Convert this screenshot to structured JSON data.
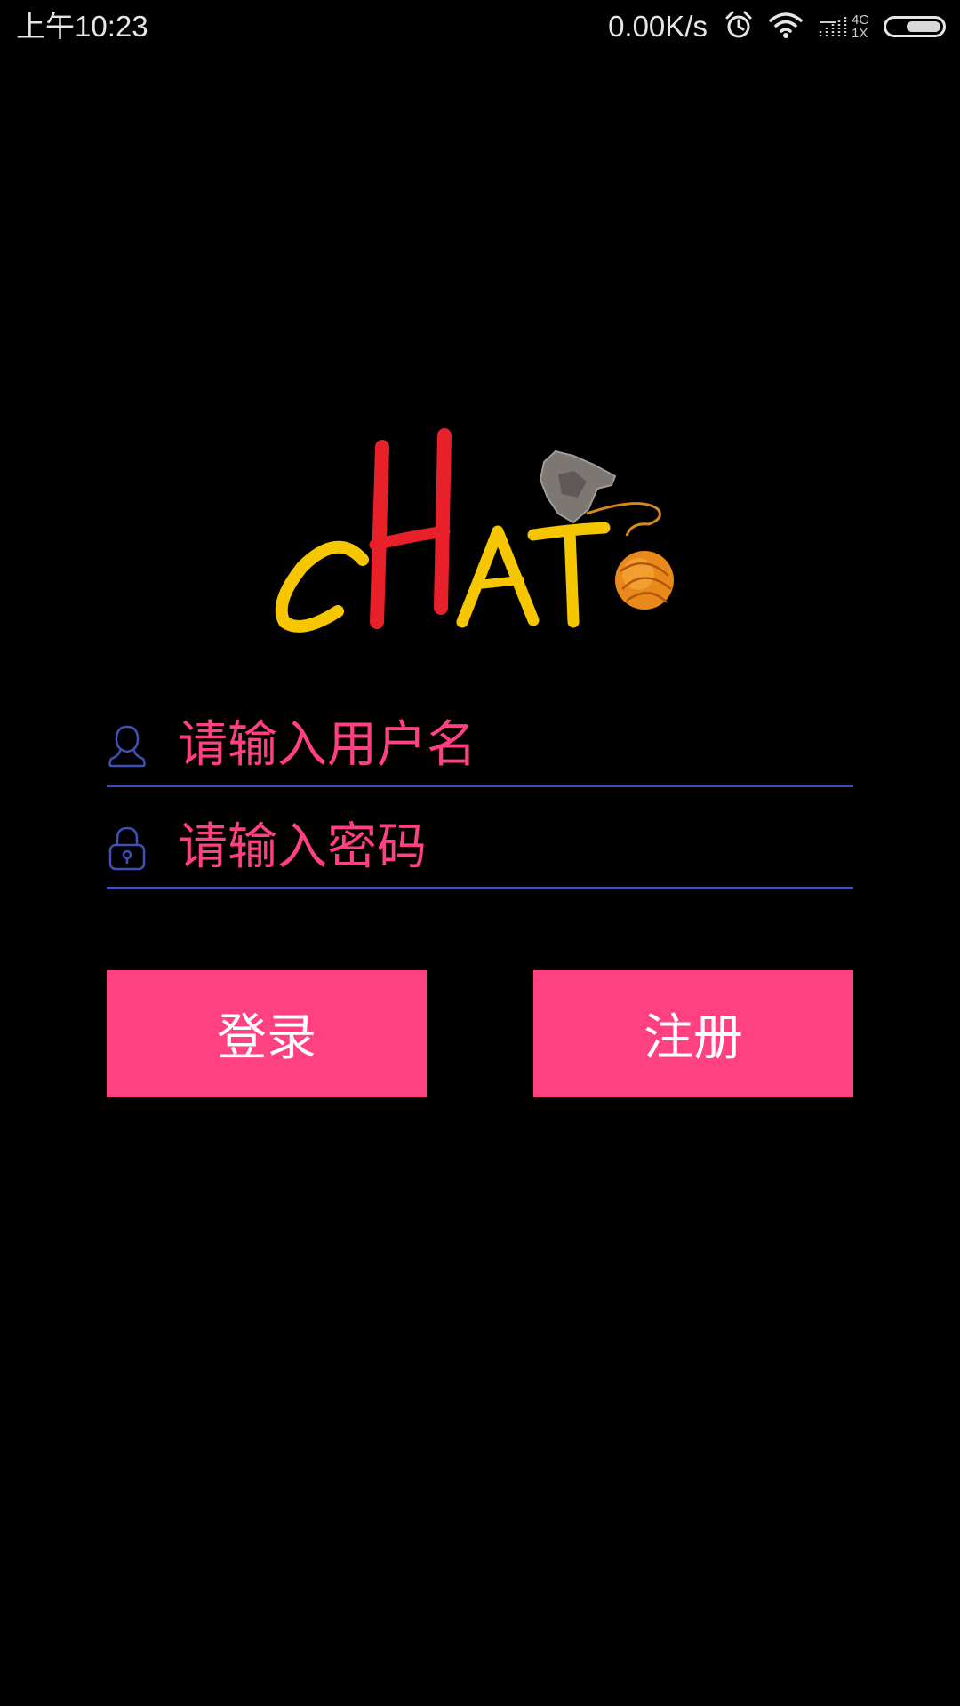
{
  "status_bar": {
    "time": "上午10:23",
    "speed": "0.00K/s",
    "network_type": "4G",
    "network_sub": "1X",
    "battery_level": 0.65,
    "icons": [
      "alarm-clock-icon",
      "wifi-icon",
      "signal-icon",
      "battery-icon"
    ]
  },
  "logo": {
    "text": "cHATo",
    "colors": {
      "primary": "#f6c600",
      "accent": "#e8202a",
      "ball": "#e8891a"
    }
  },
  "form": {
    "username_placeholder": "请输入用户名",
    "password_placeholder": "请输入密码",
    "username_value": "",
    "password_value": "",
    "username_icon": "user-icon",
    "password_icon": "lock-icon"
  },
  "buttons": {
    "login_label": "登录",
    "register_label": "注册"
  },
  "colors": {
    "background": "#000000",
    "accent_pink": "#ff4081",
    "underline_indigo": "#3f51b5"
  }
}
